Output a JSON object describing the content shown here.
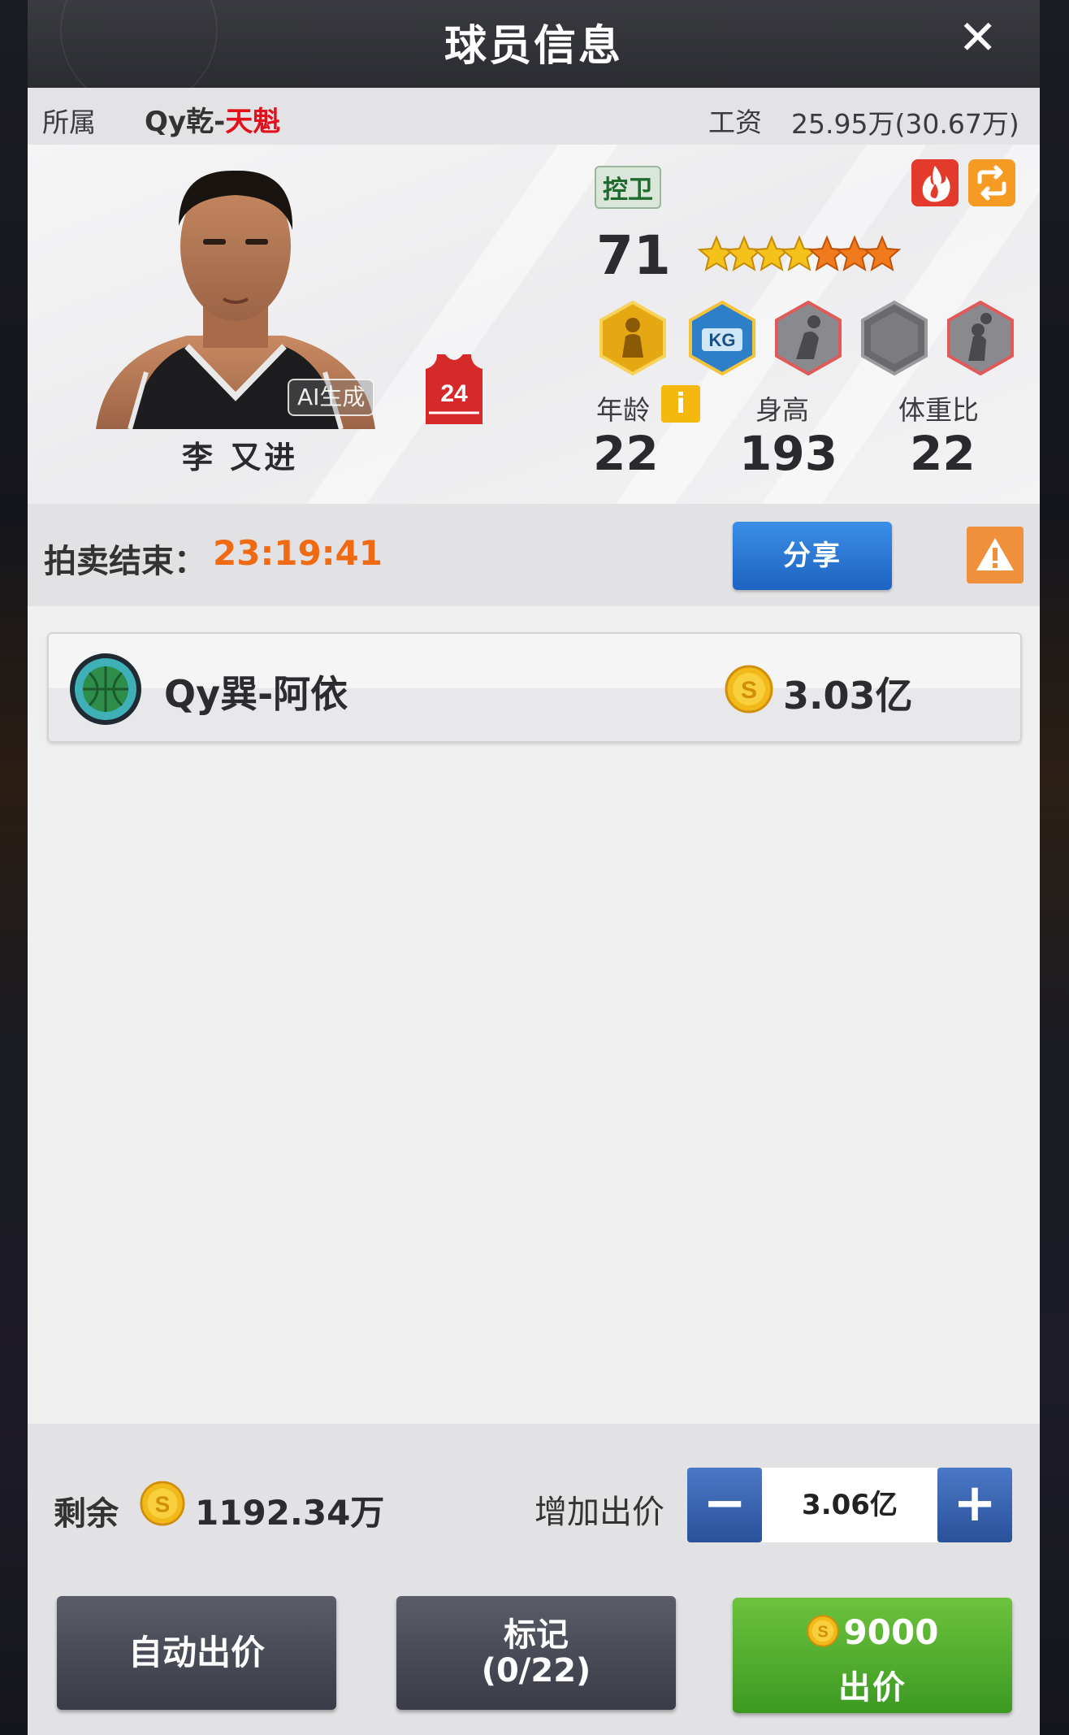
{
  "header": {
    "title": "球员信息",
    "close_glyph": "✕"
  },
  "info": {
    "team_label": "所属",
    "team_prefix": "Qy乾-",
    "team_suffix": "天魁",
    "salary_label": "工资",
    "salary_value": "25.95万(30.67万)"
  },
  "player": {
    "ai_badge": "AI生成",
    "jersey_number": "24",
    "name": "李 又进",
    "position": "控卫",
    "rating": "71",
    "stars": {
      "total": 7,
      "gold": 4,
      "orange": 3
    },
    "badges": [
      "gold-player-badge",
      "kg-badge",
      "dunk-badge",
      "blank-badge",
      "shot-badge"
    ],
    "stats": [
      {
        "label": "年龄",
        "value": "22"
      },
      {
        "label": "身高",
        "value": "193"
      },
      {
        "label": "体重比",
        "value": "22"
      }
    ],
    "info_glyph": "i"
  },
  "auction": {
    "end_label": "拍卖结束：",
    "end_time": "23:19:41",
    "share_label": "分享"
  },
  "bids": [
    {
      "bidder": "Qy巽-阿依",
      "amount": "3.03亿"
    }
  ],
  "bottom": {
    "remain_label": "剩余",
    "remain_value": "1192.34万",
    "increase_label": "增加出价",
    "bid_value": "3.06亿",
    "minus_glyph": "−",
    "plus_glyph": "+",
    "auto_bid_label": "自动出价",
    "mark_label": "标记",
    "mark_count": "(0/22)",
    "bid_cost": "9000",
    "bid_label": "出价"
  },
  "colors": {
    "accent_red": "#e3101a",
    "timer_orange": "#f06a14",
    "share_blue": "#1e63c2",
    "bid_green": "#3c9a22"
  }
}
